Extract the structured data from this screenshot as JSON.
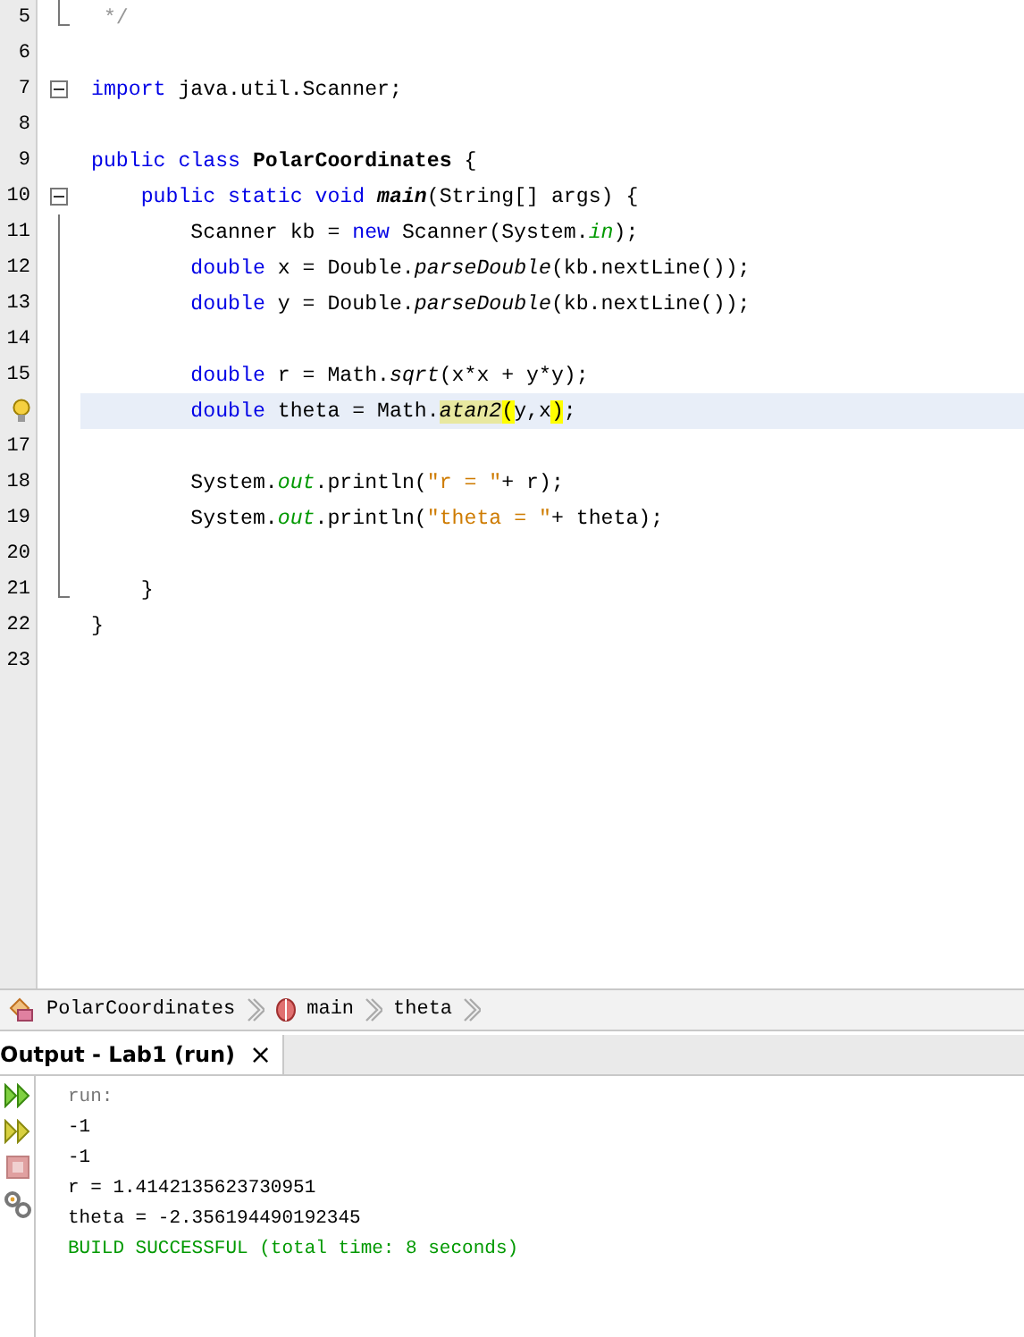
{
  "editor": {
    "lines": [
      {
        "number": "5",
        "kind": "fold-end",
        "tokens": [
          {
            "kind": "comment",
            "text": " */"
          }
        ]
      },
      {
        "number": "6",
        "kind": "plain"
      },
      {
        "number": "7",
        "kind": "fold-start",
        "tokens": [
          {
            "kind": "keyword",
            "text": "import"
          },
          {
            "kind": "plain",
            "text": " java.util.Scanner;"
          }
        ]
      },
      {
        "number": "8",
        "kind": "plain"
      },
      {
        "number": "9",
        "kind": "plain",
        "tokens": [
          {
            "kind": "keyword",
            "text": "public class "
          },
          {
            "kind": "bold",
            "text": "PolarCoordinates"
          },
          {
            "kind": "plain",
            "text": " {"
          }
        ]
      },
      {
        "number": "10",
        "kind": "fold-start",
        "tokens": [
          {
            "kind": "keyword",
            "text": "    public static void "
          },
          {
            "kind": "bolditalic",
            "text": "main"
          },
          {
            "kind": "plain",
            "text": "(String[] args) {"
          }
        ]
      },
      {
        "number": "11",
        "kind": "fold-body",
        "tokens": [
          {
            "kind": "plain",
            "text": "        Scanner kb = "
          },
          {
            "kind": "keyword",
            "text": "new"
          },
          {
            "kind": "plain",
            "text": " Scanner(System."
          },
          {
            "kind": "field",
            "text": "in"
          },
          {
            "kind": "plain",
            "text": ");"
          }
        ]
      },
      {
        "number": "12",
        "kind": "fold-body",
        "tokens": [
          {
            "kind": "keyword",
            "text": "        double"
          },
          {
            "kind": "plain",
            "text": " x = Double."
          },
          {
            "kind": "italic",
            "text": "parseDouble"
          },
          {
            "kind": "plain",
            "text": "(kb.nextLine());"
          }
        ]
      },
      {
        "number": "13",
        "kind": "fold-body",
        "tokens": [
          {
            "kind": "keyword",
            "text": "        double"
          },
          {
            "kind": "plain",
            "text": " y = Double."
          },
          {
            "kind": "italic",
            "text": "parseDouble"
          },
          {
            "kind": "plain",
            "text": "(kb.nextLine());"
          }
        ]
      },
      {
        "number": "14",
        "kind": "fold-body"
      },
      {
        "number": "15",
        "kind": "fold-body",
        "tokens": [
          {
            "kind": "keyword",
            "text": "        double"
          },
          {
            "kind": "plain",
            "text": " r = Math."
          },
          {
            "kind": "italic",
            "text": "sqrt"
          },
          {
            "kind": "plain",
            "text": "(x*x + y*y);"
          }
        ]
      },
      {
        "kind": "fold-body",
        "current": true,
        "hint": true,
        "tokens": [
          {
            "kind": "keyword",
            "text": "        double"
          },
          {
            "kind": "plain",
            "text": " theta = Math."
          },
          {
            "kind": "marked",
            "text": "atan2"
          },
          {
            "kind": "match",
            "text": "("
          },
          {
            "kind": "plain",
            "text": "y,x"
          },
          {
            "kind": "match",
            "text": ")"
          },
          {
            "kind": "plain",
            "text": ";"
          }
        ]
      },
      {
        "number": "17",
        "kind": "fold-body"
      },
      {
        "number": "18",
        "kind": "fold-body",
        "tokens": [
          {
            "kind": "plain",
            "text": "        System."
          },
          {
            "kind": "field",
            "text": "out"
          },
          {
            "kind": "plain",
            "text": ".println("
          },
          {
            "kind": "string",
            "text": "\"r = \""
          },
          {
            "kind": "plain",
            "text": "+ r);"
          }
        ]
      },
      {
        "number": "19",
        "kind": "fold-body",
        "tokens": [
          {
            "kind": "plain",
            "text": "        System."
          },
          {
            "kind": "field",
            "text": "out"
          },
          {
            "kind": "plain",
            "text": ".println("
          },
          {
            "kind": "string",
            "text": "\"theta = \""
          },
          {
            "kind": "plain",
            "text": "+ theta);"
          }
        ]
      },
      {
        "number": "20",
        "kind": "fold-body"
      },
      {
        "number": "21",
        "kind": "fold-end",
        "tokens": [
          {
            "kind": "plain",
            "text": "    }"
          }
        ]
      },
      {
        "number": "22",
        "kind": "plain",
        "tokens": [
          {
            "kind": "plain",
            "text": "}"
          }
        ]
      },
      {
        "number": "23",
        "kind": "plain"
      }
    ]
  },
  "breadcrumbs": [
    {
      "kind": "class",
      "label": "PolarCoordinates"
    },
    {
      "kind": "method",
      "label": "main"
    },
    {
      "kind": "variable",
      "label": "theta"
    }
  ],
  "output": {
    "tab": {
      "label": "Output - Lab1 (run)",
      "close": "×"
    },
    "lines": [
      {
        "kind": "info",
        "text": "run:"
      },
      {
        "kind": "plain",
        "text": "-1"
      },
      {
        "kind": "plain",
        "text": "-1"
      },
      {
        "kind": "plain",
        "text": "r = 1.4142135623730951"
      },
      {
        "kind": "plain",
        "text": "theta = -2.356194490192345"
      },
      {
        "kind": "success",
        "text": "BUILD SUCCESSFUL (total time: 8 seconds)"
      }
    ]
  }
}
